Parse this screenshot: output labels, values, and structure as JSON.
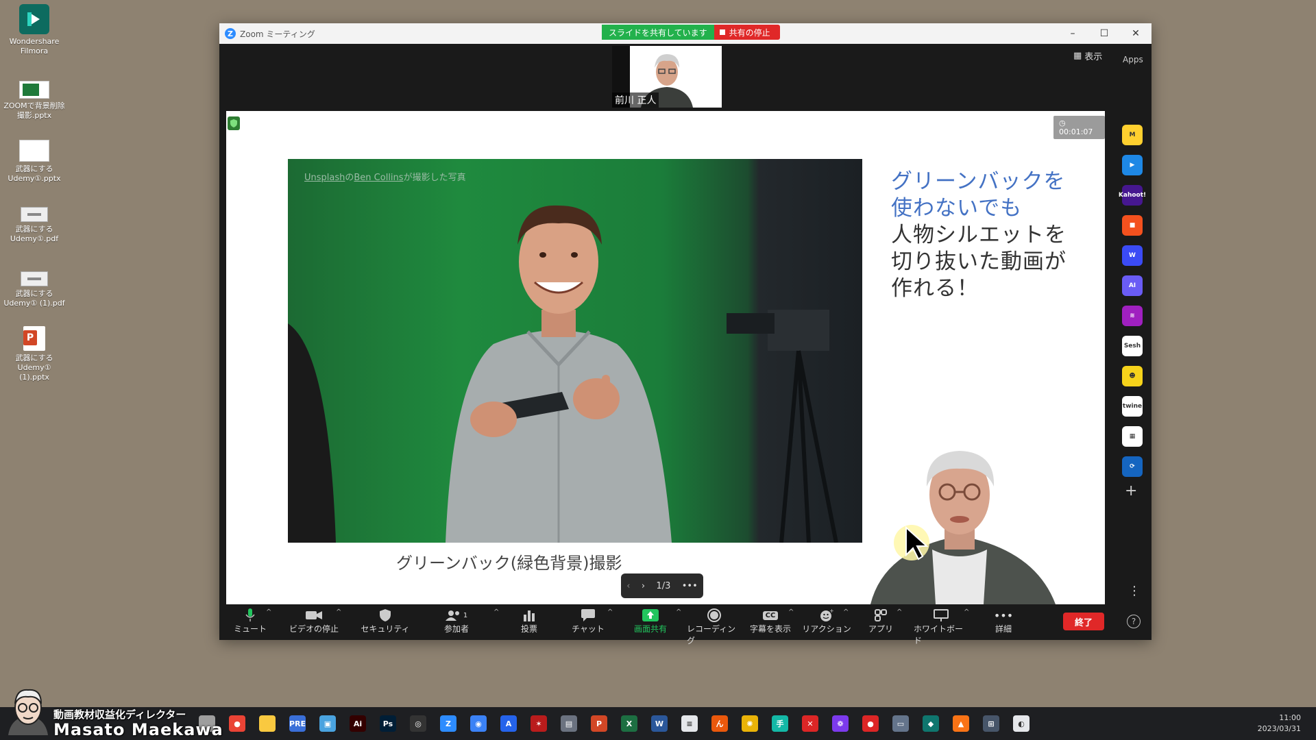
{
  "desktop": {
    "icons": [
      {
        "label": "Wondershare Filmora",
        "icon": "filmora-icon"
      },
      {
        "label": "ZOOMで背景削除撮影.pptx",
        "icon": "pptx-thumbnail-icon"
      },
      {
        "label": "武器にするUdemy①.pptx",
        "icon": "pptx-blank-icon"
      },
      {
        "label": "武器にするUdemy①.pdf",
        "icon": "pdf-thumbnail-icon"
      },
      {
        "label": "武器にするUdemy① (1).pdf",
        "icon": "pdf-thumbnail-icon"
      },
      {
        "label": "武器にするUdemy① (1).pptx",
        "icon": "powerpoint-icon"
      }
    ]
  },
  "window": {
    "title": "Zoom ミーティング",
    "sharing_label": "スライドを共有しています",
    "stop_share_label": "共有の停止"
  },
  "top": {
    "participant_name": "前川 正人",
    "view_label": "表示",
    "apps_label": "Apps"
  },
  "slide": {
    "timer": "00:01:07",
    "photo_credit": {
      "site": "Unsplash",
      "connector": "の",
      "author": "Ben Collins",
      "suffix": "が撮影した写真"
    },
    "heading_blue_1": "グリーンバックを",
    "heading_blue_2": "使わないでも",
    "heading_dark_1": "人物シルエットを",
    "heading_dark_2": "切り抜いた動画が",
    "heading_dark_3": "作れる！",
    "caption": "グリーンバック(緑色背景)撮影",
    "page_indicator": "1/3"
  },
  "apps_sidebar": [
    {
      "name": "miro",
      "color": "#ffd02f",
      "text": "M"
    },
    {
      "name": "tool-blue",
      "color": "#1e88e5",
      "text": "▶"
    },
    {
      "name": "kahoot",
      "color": "#46178f",
      "text": "Kahoot!"
    },
    {
      "name": "tool-red",
      "color": "#f4511e",
      "text": "■"
    },
    {
      "name": "wooclap",
      "color": "#3b4bf5",
      "text": "W"
    },
    {
      "name": "ai-app",
      "color": "#6a5cf5",
      "text": "AI"
    },
    {
      "name": "tool-purple",
      "color": "#a020c0",
      "text": "≋"
    },
    {
      "name": "sesh",
      "color": "#ffffff",
      "text": "Sesh"
    },
    {
      "name": "emoji-app",
      "color": "#f6d31b",
      "text": "☻"
    },
    {
      "name": "twine",
      "color": "#ffffff",
      "text": "twine"
    },
    {
      "name": "grid-app",
      "color": "#ffffff",
      "text": "▦"
    },
    {
      "name": "sync-app",
      "color": "#1565c0",
      "text": "⟳"
    }
  ],
  "toolbar": {
    "mute": "ミュート",
    "video": "ビデオの停止",
    "security": "セキュリティ",
    "participants": "参加者",
    "participants_count": "1",
    "polls": "投票",
    "chat": "チャット",
    "share": "画面共有",
    "record": "レコーディング",
    "captions": "字幕を表示",
    "captions_badge": "CC",
    "reactions": "リアクション",
    "apps": "アプリ",
    "whiteboard": "ホワイトボード",
    "more": "詳細",
    "end": "終了",
    "accent_green": "#22c55e",
    "end_color": "#e02828"
  },
  "overlay": {
    "role": "動画教材収益化ディレクター",
    "name": "Masato Maekawa"
  },
  "taskbar": {
    "time": "11:00",
    "date": "2023/03/31",
    "apps": [
      {
        "name": "desktop",
        "color": "#9e9e9e",
        "text": ""
      },
      {
        "name": "chrome",
        "color": "#ea4335",
        "text": "●"
      },
      {
        "name": "explorer",
        "color": "#f9c940",
        "text": ""
      },
      {
        "name": "premiere-rush",
        "color": "#3a6fd8",
        "text": "PRE"
      },
      {
        "name": "control-panel",
        "color": "#4aa3df",
        "text": "▣"
      },
      {
        "name": "illustrator",
        "color": "#330000",
        "text": "Ai"
      },
      {
        "name": "photoshop",
        "color": "#001e36",
        "text": "Ps"
      },
      {
        "name": "obs",
        "color": "#333333",
        "text": "◎"
      },
      {
        "name": "zoom",
        "color": "#2d8cff",
        "text": "Z"
      },
      {
        "name": "zoom-alt",
        "color": "#3b82f6",
        "text": "◉"
      },
      {
        "name": "app-blue",
        "color": "#2563eb",
        "text": "A"
      },
      {
        "name": "app-red",
        "color": "#b91c1c",
        "text": "✶"
      },
      {
        "name": "app-grey",
        "color": "#6b7280",
        "text": "▤"
      },
      {
        "name": "powerpoint",
        "color": "#d24726",
        "text": "P"
      },
      {
        "name": "excel",
        "color": "#1d6f42",
        "text": "X"
      },
      {
        "name": "word",
        "color": "#2b579a",
        "text": "W"
      },
      {
        "name": "notepad",
        "color": "#e5e7eb",
        "text": "≡"
      },
      {
        "name": "app-orange",
        "color": "#ea580c",
        "text": "ん"
      },
      {
        "name": "app-yellow",
        "color": "#eab308",
        "text": "✺"
      },
      {
        "name": "app-teal",
        "color": "#14b8a6",
        "text": "手"
      },
      {
        "name": "app-x",
        "color": "#dc2626",
        "text": "✕"
      },
      {
        "name": "davinci",
        "color": "#7c3aed",
        "text": "❁"
      },
      {
        "name": "recorder",
        "color": "#dc2626",
        "text": "●"
      },
      {
        "name": "app-monitor",
        "color": "#64748b",
        "text": "▭"
      },
      {
        "name": "filmora",
        "color": "#0f766e",
        "text": "◆"
      },
      {
        "name": "vlc",
        "color": "#f97316",
        "text": "▲"
      },
      {
        "name": "app-network",
        "color": "#475569",
        "text": "⊞"
      },
      {
        "name": "app-chat",
        "color": "#e5e7eb",
        "text": "◐"
      }
    ]
  }
}
